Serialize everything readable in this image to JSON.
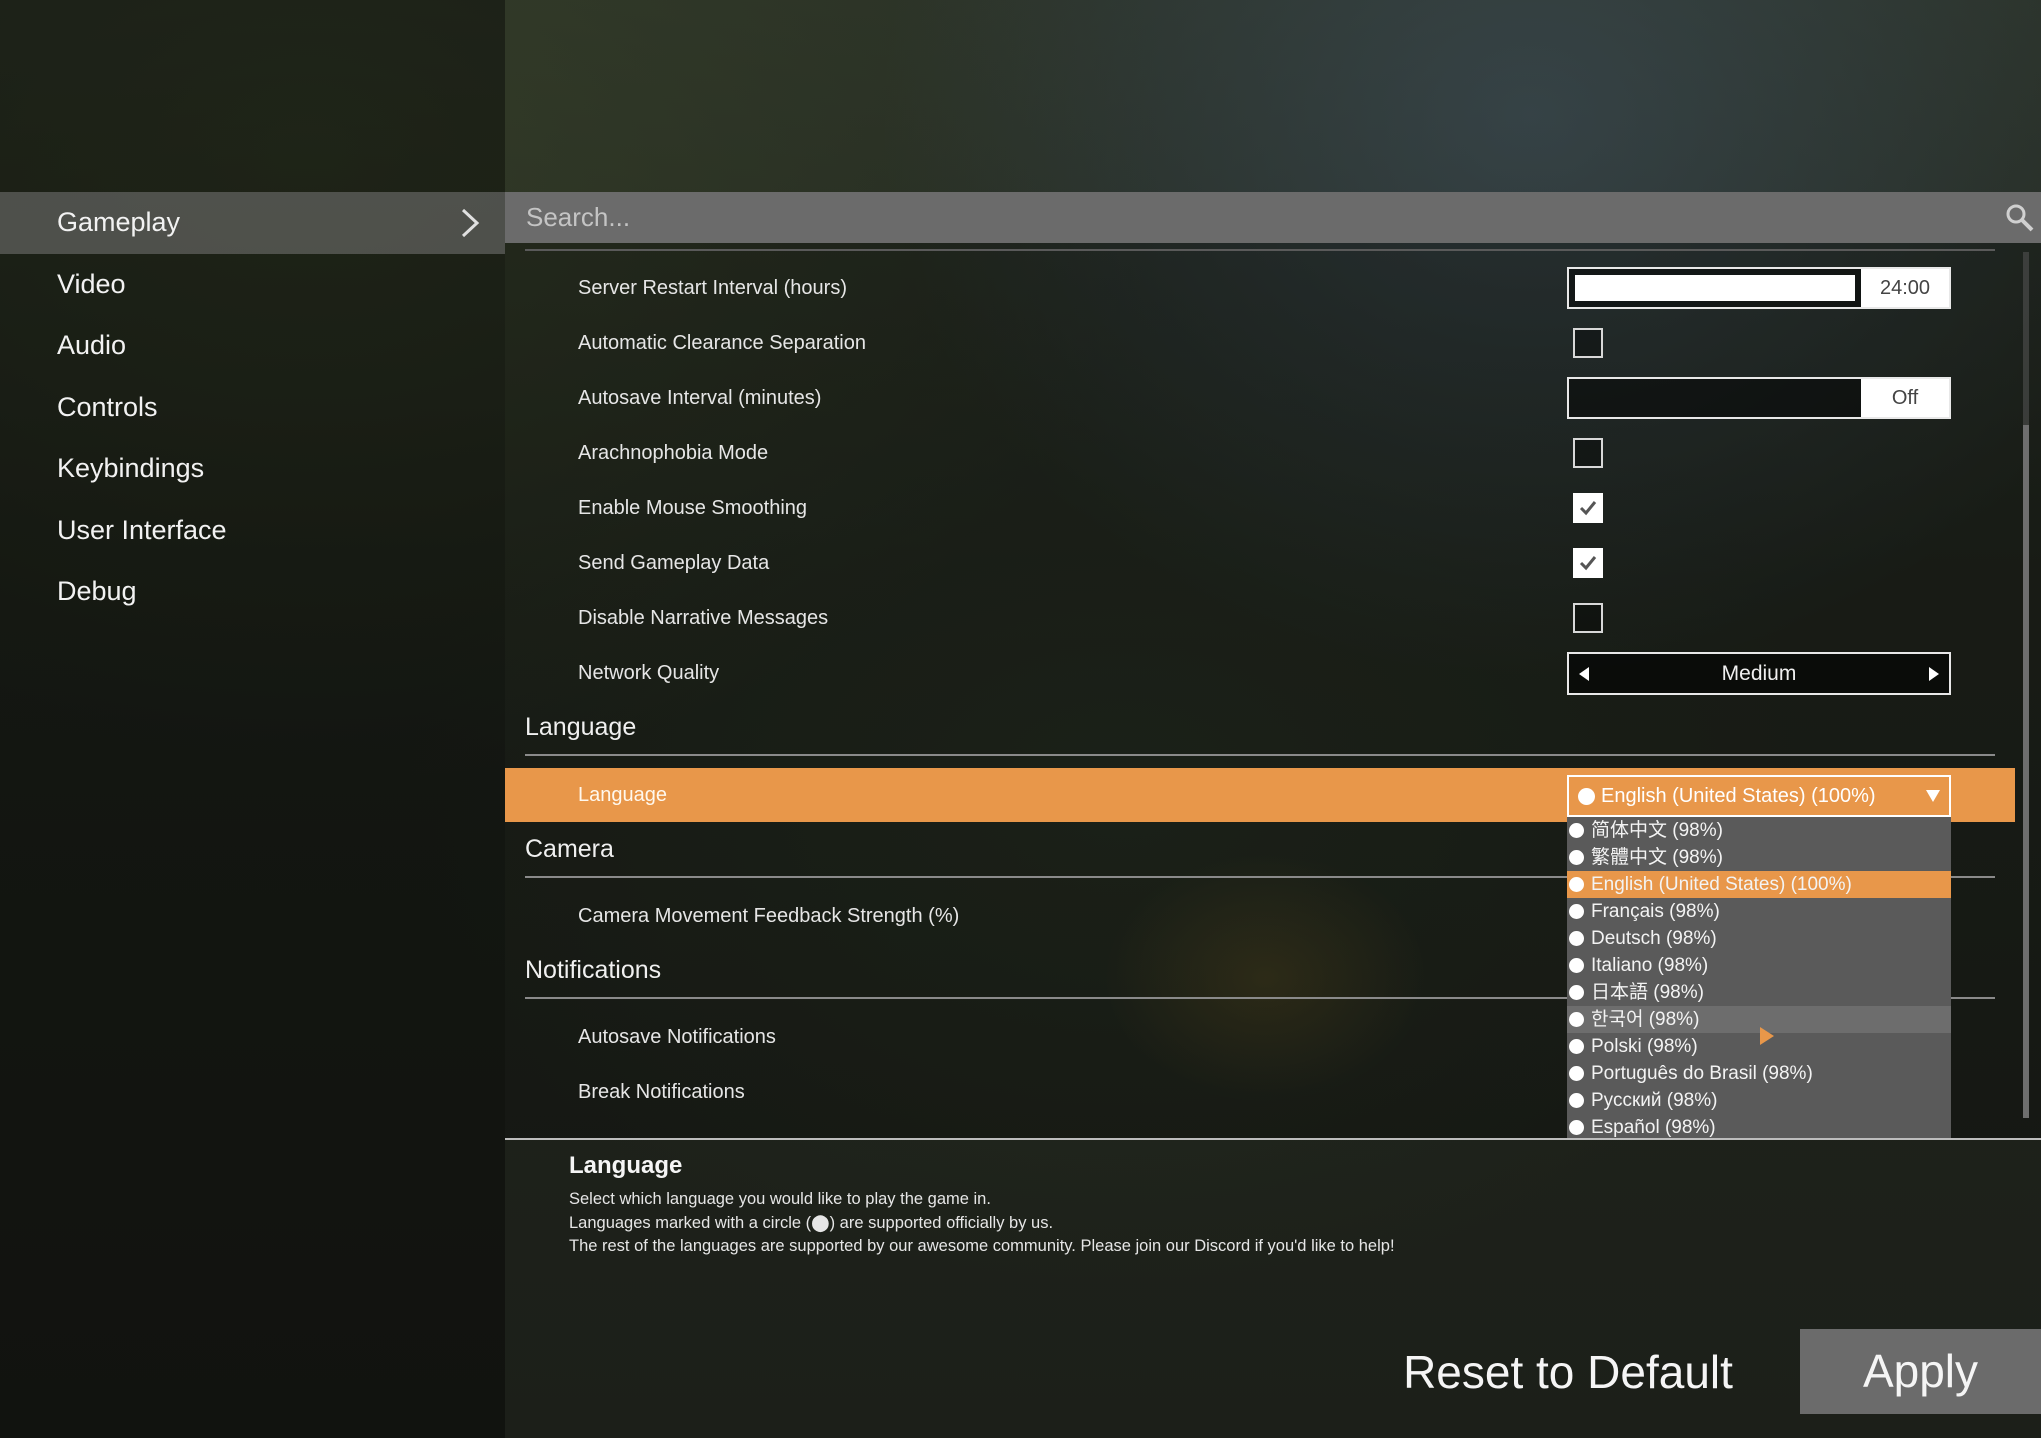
{
  "sidebar": {
    "items": [
      {
        "label": "Gameplay",
        "active": true
      },
      {
        "label": "Video"
      },
      {
        "label": "Audio"
      },
      {
        "label": "Controls"
      },
      {
        "label": "Keybindings"
      },
      {
        "label": "User Interface"
      },
      {
        "label": "Debug"
      }
    ]
  },
  "search": {
    "placeholder": "Search..."
  },
  "settings": {
    "server_restart": {
      "label": "Server Restart Interval (hours)",
      "value": "24:00",
      "fill_fraction": 1.0
    },
    "clearance": {
      "label": "Automatic Clearance Separation",
      "checked": false
    },
    "autosave": {
      "label": "Autosave Interval (minutes)",
      "value": "Off",
      "fill_fraction": 0.0
    },
    "arachnophobia": {
      "label": "Arachnophobia Mode",
      "checked": false
    },
    "mouse_smoothing": {
      "label": "Enable Mouse Smoothing",
      "checked": true
    },
    "gameplay_data": {
      "label": "Send Gameplay Data",
      "checked": true
    },
    "narrative": {
      "label": "Disable Narrative Messages",
      "checked": false
    },
    "network": {
      "label": "Network Quality",
      "value": "Medium"
    }
  },
  "sections": {
    "language": "Language",
    "camera": "Camera",
    "notifications": "Notifications"
  },
  "language_row": {
    "label": "Language",
    "selected": "English (United States) (100%)",
    "options": [
      "简体中文 (98%)",
      "繁體中文 (98%)",
      "English (United States) (100%)",
      "Français (98%)",
      "Deutsch (98%)",
      "Italiano (98%)",
      "日本語 (98%)",
      "한국어 (98%)",
      "Polski (98%)",
      "Português do Brasil (98%)",
      "Русский (98%)",
      "Español (98%)"
    ]
  },
  "camera_row": {
    "label": "Camera Movement Feedback Strength (%)"
  },
  "notification_rows": {
    "autosave": "Autosave Notifications",
    "break": "Break Notifications"
  },
  "description": {
    "title": "Language",
    "lines": [
      "Select which language you would like to play the game in.",
      "Languages marked with a circle (⬤) are supported officially by us.",
      "The rest of the languages are supported by our awesome community. Please join our Discord if you'd like to help!"
    ]
  },
  "buttons": {
    "reset": "Reset to Default",
    "apply": "Apply"
  },
  "colors": {
    "accent": "#e8974a",
    "panel": "#6b6b6b"
  }
}
